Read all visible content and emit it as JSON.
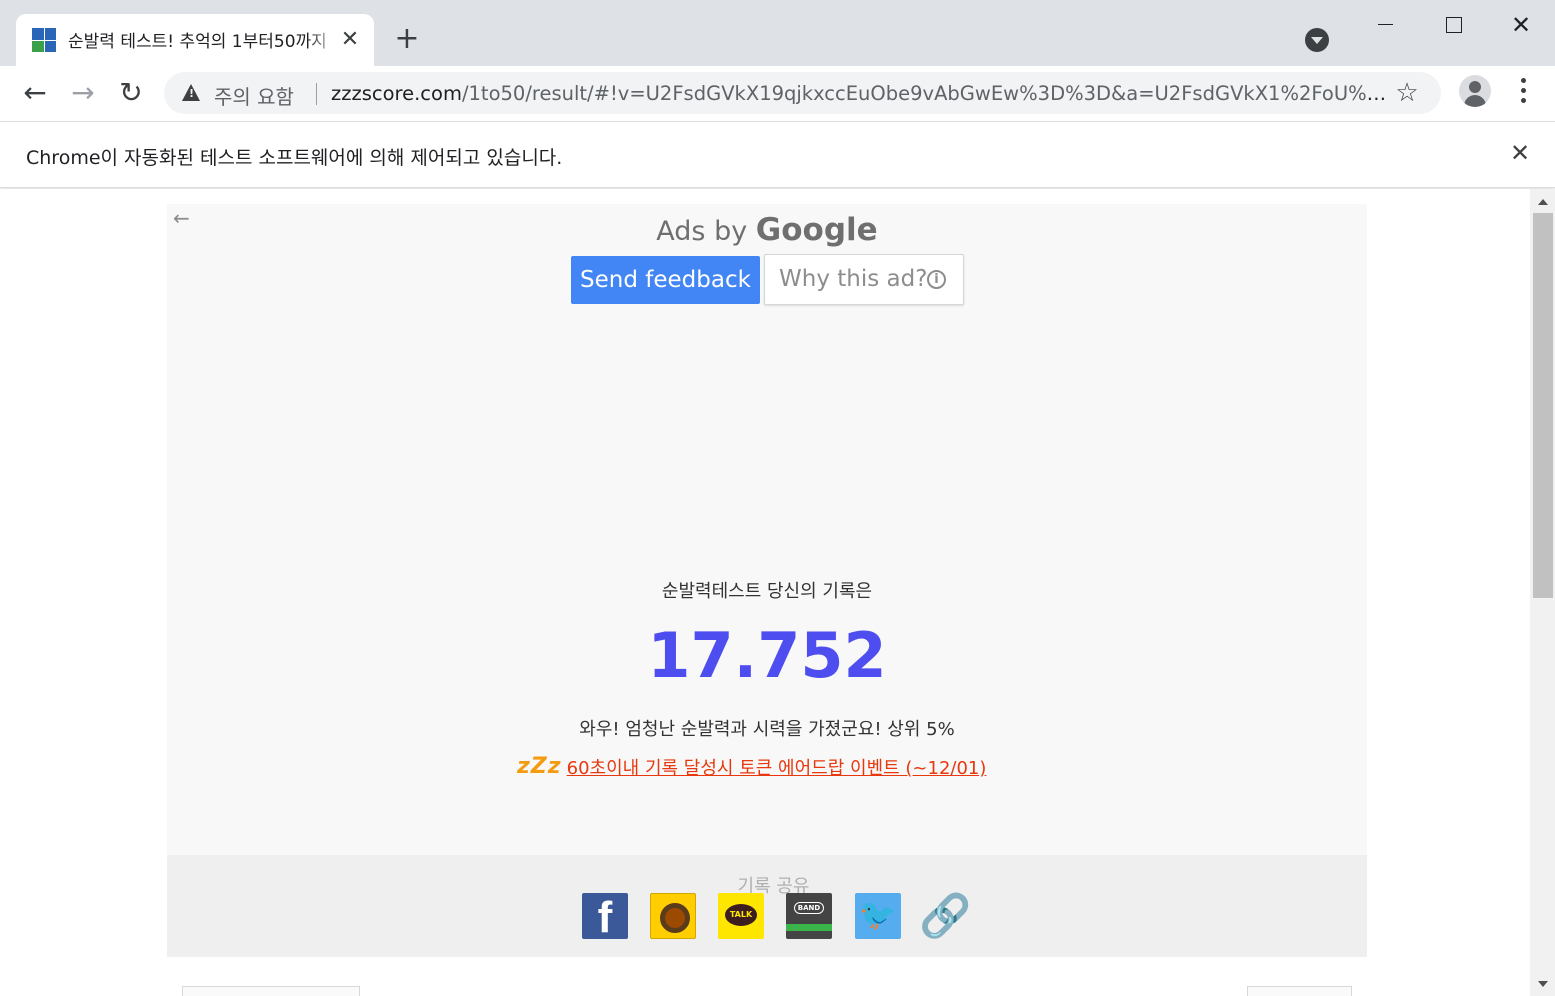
{
  "tab": {
    "title": "순발력 테스트! 추억의 1부터50까지",
    "close_glyph": "✕",
    "favicon_colors": [
      "#2a66b8",
      "#2a66b8",
      "#3aa04a",
      "#2a66b8"
    ]
  },
  "new_tab_glyph": "+",
  "window": {
    "minimize": "",
    "maximize": "",
    "close": "✕"
  },
  "toolbar": {
    "back_glyph": "←",
    "forward_glyph": "→",
    "reload_glyph": "↻",
    "security_warning": "주의 요함",
    "url_host": "zzzscore.com",
    "url_path": "/1to50/result/#!v=U2FsdGVkX19qjkxccEuObe9vAbGwEw%3D%3D&a=U2FsdGVkX1%2FoU%2Fvl...",
    "star_glyph": "☆"
  },
  "infobar": {
    "message": "Chrome이 자동화된 테스트 소프트웨어에 의해 제어되고 있습니다.",
    "close_glyph": "✕"
  },
  "ad": {
    "back_glyph": "←",
    "ads_by": "Ads by",
    "google": "Google",
    "send_feedback": "Send feedback",
    "why_this_ad": "Why this ad?",
    "info_glyph": "i"
  },
  "result": {
    "label": "순발력테스트 당신의 기록은",
    "score": "17.752",
    "message": "와우! 엄청난 순발력과 시력을 가졌군요! 상위 5%",
    "event_logo": "zZz",
    "event_link": "60초이내 기록 달성시 토큰 에어드랍 이벤트 (~12/01)"
  },
  "share": {
    "title": "기록 공유",
    "facebook_glyph": "f",
    "kakaotalk_label": "TALK",
    "band_label": "BAND",
    "twitter_glyph": "🐦",
    "link_glyph": "🔗"
  },
  "colors": {
    "score": "#4e4ef0",
    "feedback_button": "#4285f4",
    "event_link": "#e8380d",
    "tabstrip": "#dee1e6"
  }
}
